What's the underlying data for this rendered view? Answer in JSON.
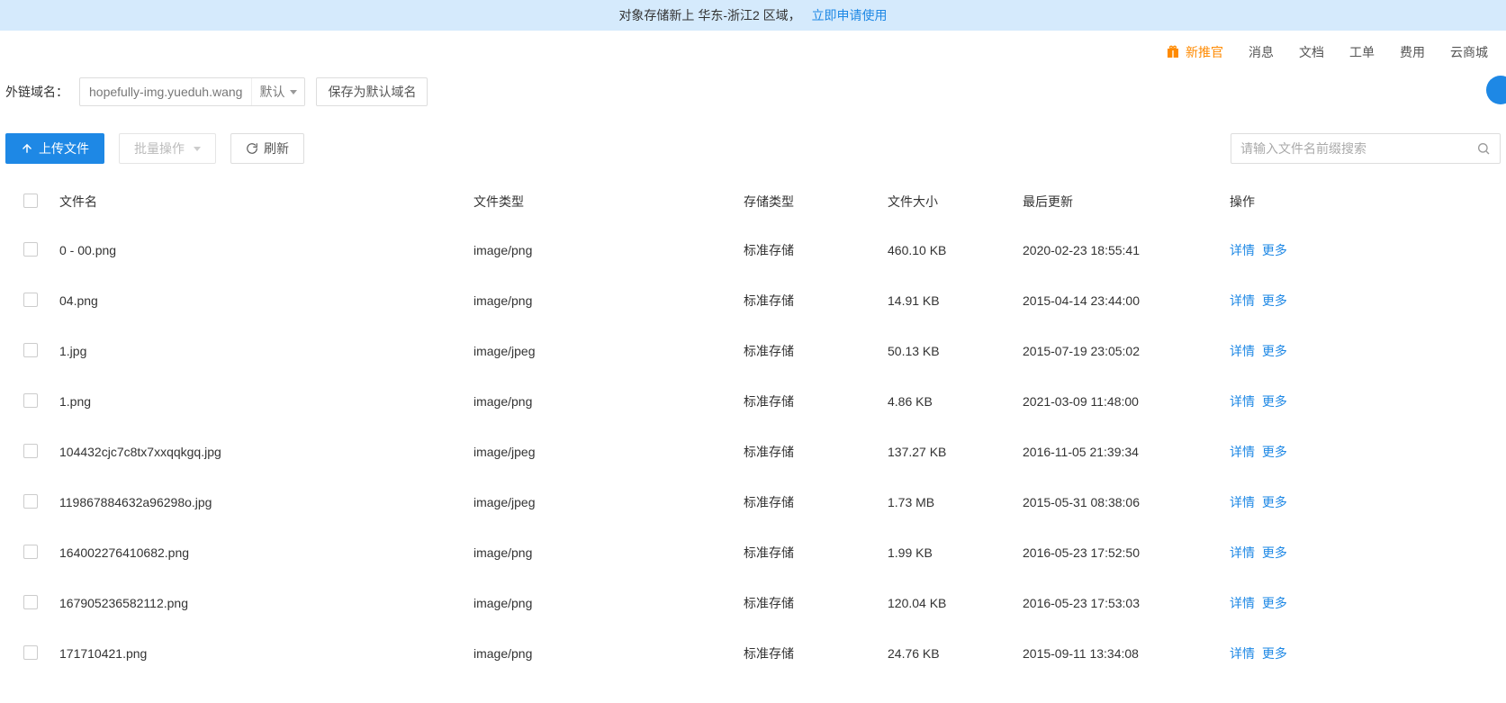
{
  "banner": {
    "text": "对象存储新上 华东-浙江2 区域，",
    "link": "立即申请使用"
  },
  "topnav": {
    "promo": "新推官",
    "items": [
      "消息",
      "文档",
      "工单",
      "费用",
      "云商城"
    ]
  },
  "domain": {
    "label": "外链域名：",
    "value": "hopefully-img.yueduh.wang",
    "type_label": "默认",
    "save_default": "保存为默认域名"
  },
  "toolbar": {
    "upload": "上传文件",
    "batch": "批量操作",
    "refresh": "刷新",
    "search_placeholder": "请输入文件名前缀搜索"
  },
  "table": {
    "headers": {
      "name": "文件名",
      "type": "文件类型",
      "storage": "存储类型",
      "size": "文件大小",
      "updated": "最后更新",
      "ops": "操作"
    },
    "detail_label": "详情",
    "more_label": "更多",
    "rows": [
      {
        "name": "0 - 00.png",
        "type": "image/png",
        "storage": "标准存储",
        "size": "460.10 KB",
        "updated": "2020-02-23 18:55:41"
      },
      {
        "name": "04.png",
        "type": "image/png",
        "storage": "标准存储",
        "size": "14.91 KB",
        "updated": "2015-04-14 23:44:00"
      },
      {
        "name": "1.jpg",
        "type": "image/jpeg",
        "storage": "标准存储",
        "size": "50.13 KB",
        "updated": "2015-07-19 23:05:02"
      },
      {
        "name": "1.png",
        "type": "image/png",
        "storage": "标准存储",
        "size": "4.86 KB",
        "updated": "2021-03-09 11:48:00"
      },
      {
        "name": "104432cjc7c8tx7xxqqkgq.jpg",
        "type": "image/jpeg",
        "storage": "标准存储",
        "size": "137.27 KB",
        "updated": "2016-11-05 21:39:34"
      },
      {
        "name": "119867884632a96298o.jpg",
        "type": "image/jpeg",
        "storage": "标准存储",
        "size": "1.73 MB",
        "updated": "2015-05-31 08:38:06"
      },
      {
        "name": "164002276410682.png",
        "type": "image/png",
        "storage": "标准存储",
        "size": "1.99 KB",
        "updated": "2016-05-23 17:52:50"
      },
      {
        "name": "167905236582112.png",
        "type": "image/png",
        "storage": "标准存储",
        "size": "120.04 KB",
        "updated": "2016-05-23 17:53:03"
      },
      {
        "name": "171710421.png",
        "type": "image/png",
        "storage": "标准存储",
        "size": "24.76 KB",
        "updated": "2015-09-11 13:34:08"
      }
    ]
  }
}
